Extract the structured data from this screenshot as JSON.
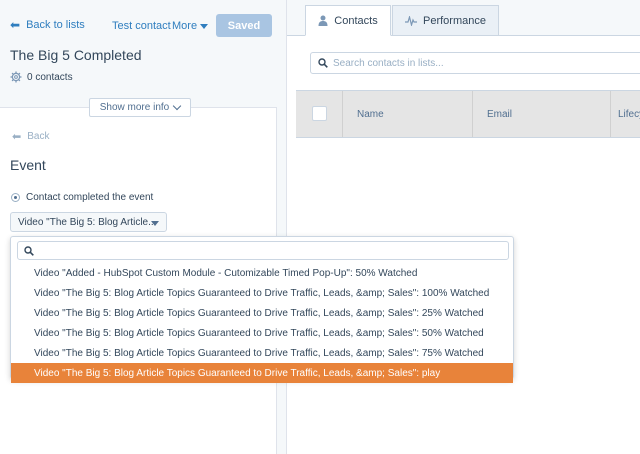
{
  "header": {
    "back_label": "Back to lists",
    "test_contact_label": "Test contact",
    "more_label": "More",
    "saved_label": "Saved"
  },
  "list": {
    "title": "The Big 5 Completed",
    "contacts_count": "0 contacts",
    "show_more_label": "Show more info"
  },
  "filter": {
    "back_label": "Back",
    "heading": "Event",
    "radio_label": "Contact completed the event",
    "selected_video": "Video \"The Big 5: Blog Article..."
  },
  "tabs": [
    {
      "label": "Contacts",
      "icon": "person-icon",
      "active": true
    },
    {
      "label": "Performance",
      "icon": "pulse-icon",
      "active": false
    }
  ],
  "search": {
    "placeholder": "Search contacts in lists..."
  },
  "table": {
    "columns": [
      "Name",
      "Email",
      "Lifecycle"
    ]
  },
  "dropdown": {
    "options": [
      "Video \"Added - HubSpot Custom Module - Cutomizable Timed Pop-Up\": 50% Watched",
      "Video \"The Big 5: Blog Article Topics Guaranteed to Drive Traffic, Leads, &amp; Sales\": 100% Watched",
      "Video \"The Big 5: Blog Article Topics Guaranteed to Drive Traffic, Leads, &amp; Sales\": 25% Watched",
      "Video \"The Big 5: Blog Article Topics Guaranteed to Drive Traffic, Leads, &amp; Sales\": 50% Watched",
      "Video \"The Big 5: Blog Article Topics Guaranteed to Drive Traffic, Leads, &amp; Sales\": 75% Watched",
      "Video \"The Big 5: Blog Article Topics Guaranteed to Drive Traffic, Leads, &amp; Sales\": play"
    ],
    "selected_index": 5
  },
  "colors": {
    "link": "#2f7ebf",
    "saved_button": "#a9c5e2",
    "selected_option": "#e8833a",
    "panel_bg": "#f5f8fa"
  }
}
